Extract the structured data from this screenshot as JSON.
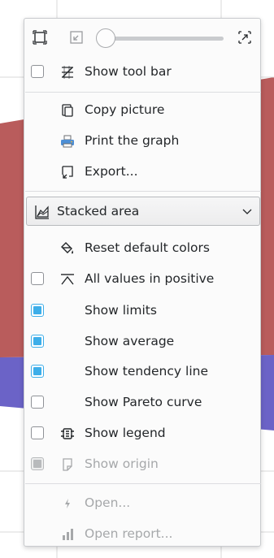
{
  "toolbar": {
    "zoom_level": 0.0
  },
  "menu": {
    "show_tool_bar": "Show tool bar",
    "copy_picture": "Copy picture",
    "print_graph": "Print the graph",
    "export": "Export...",
    "chart_type": "Stacked area",
    "reset_colors": "Reset default colors",
    "all_values_positive": "All values in positive",
    "show_limits": "Show limits",
    "show_average": "Show average",
    "show_tendency": "Show tendency line",
    "show_pareto": "Show Pareto curve",
    "show_legend": "Show legend",
    "show_origin": "Show origin",
    "open": "Open...",
    "open_report": "Open report..."
  },
  "colors": {
    "accent": "#3daee9",
    "series_red": "#b95c5c",
    "series_blue": "#6b63c7"
  }
}
